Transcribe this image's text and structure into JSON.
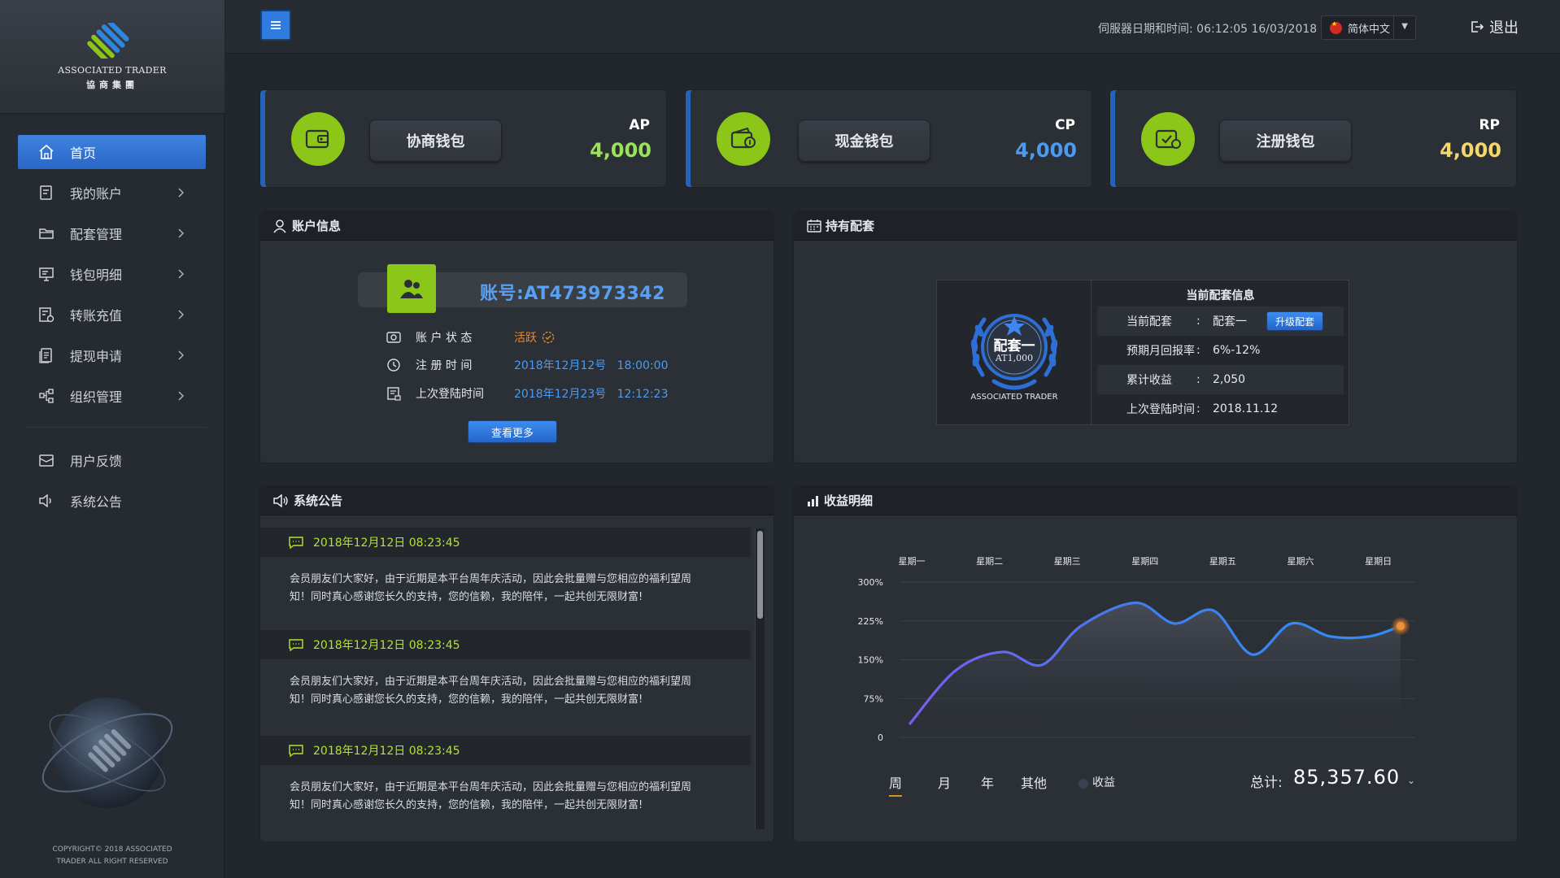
{
  "brand": {
    "name_en": "ASSOCIATED TRADER",
    "name_cn": "協商集團"
  },
  "sidebar": {
    "items": [
      {
        "label": "首页",
        "icon": "home-icon",
        "active": true
      },
      {
        "label": "我的账户",
        "icon": "account-icon"
      },
      {
        "label": "配套管理",
        "icon": "folder-icon"
      },
      {
        "label": "钱包明细",
        "icon": "monitor-icon"
      },
      {
        "label": "转账充值",
        "icon": "transfer-icon"
      },
      {
        "label": "提现申请",
        "icon": "document-icon"
      },
      {
        "label": "组织管理",
        "icon": "org-icon"
      }
    ],
    "secondary": [
      {
        "label": "用户反馈",
        "icon": "mail-icon"
      },
      {
        "label": "系统公告",
        "icon": "speaker-icon"
      }
    ],
    "copyright_line1": "COPYRIGHT© 2018 ASSOCIATED",
    "copyright_line2": "TRADER ALL RIGHT RESERVED"
  },
  "topbar": {
    "server_time": "伺服器日期和时间: 06:12:05 16/03/2018",
    "language": "简体中文",
    "logout": "退出"
  },
  "wallets": [
    {
      "label": "协商钱包",
      "code": "AP",
      "value": "4,000",
      "value_color": "#9be25a"
    },
    {
      "label": "现金钱包",
      "code": "CP",
      "value": "4,000",
      "value_color": "#4d9bf0"
    },
    {
      "label": "注册钱包",
      "code": "RP",
      "value": "4,000",
      "value_color": "#f3d768"
    }
  ],
  "account": {
    "title": "账户信息",
    "account_no": "账号:AT473973342",
    "status_label": "账 户 状 态",
    "status_value": "活跃",
    "status_color": "#f08a24",
    "reg_label": "注 册 时 间",
    "reg_value": "2018年12月12号   18:00:00",
    "last_login_label": "上次登陆时间",
    "last_login_value": "2018年12月23号   12:12:23",
    "more_button": "查看更多"
  },
  "package": {
    "title": "持有配套",
    "badge_main": "配套一",
    "badge_sub": "AT1,000",
    "badge_brand": "ASSOCIATED TRADER",
    "info_title": "当前配套信息",
    "rows": [
      {
        "key": "当前配套",
        "value": "配套一"
      },
      {
        "key": "预期月回报率",
        "value": "6%-12%"
      },
      {
        "key": "累计收益",
        "value": "2,050"
      },
      {
        "key": "上次登陆时间",
        "value": "2018.11.12"
      }
    ],
    "upgrade_button": "升级配套"
  },
  "notices": {
    "title": "系统公告",
    "items": [
      {
        "date": "2018年12月12日 08:23:45",
        "line1": "会员朋友们大家好，由于近期是本平台周年庆活动，因此会批量赠与您相应的福利望周",
        "line2": "知！同时真心感谢您长久的支持，您的信赖，我的陪伴，一起共创无限财富!"
      },
      {
        "date": "2018年12月12日 08:23:45",
        "line1": "会员朋友们大家好，由于近期是本平台周年庆活动，因此会批量赠与您相应的福利望周",
        "line2": "知！同时真心感谢您长久的支持，您的信赖，我的陪伴，一起共创无限财富!"
      },
      {
        "date": "2018年12月12日 08:23:45",
        "line1": "会员朋友们大家好，由于近期是本平台周年庆活动，因此会批量赠与您相应的福利望周",
        "line2": "知！同时真心感谢您长久的支持，您的信赖，我的陪伴，一起共创无限财富!"
      }
    ]
  },
  "earnings": {
    "title": "收益明细",
    "periods": [
      "周",
      "月",
      "年",
      "其他"
    ],
    "active_period": "周",
    "legend": "收益",
    "total_label": "总计:",
    "total_value": "85,357.60"
  },
  "chart_data": {
    "type": "line",
    "categories": [
      "星期一",
      "星期二",
      "星期三",
      "星期四",
      "星期五",
      "星期六",
      "星期日"
    ],
    "y_ticks": [
      "0",
      "75%",
      "150%",
      "225%",
      "300%"
    ],
    "ylim": [
      0,
      300
    ],
    "series": [
      {
        "name": "收益",
        "x": [
          0,
          0.6,
          1.2,
          1.7,
          2.2,
          2.9,
          3.4,
          3.9,
          4.4,
          4.9,
          5.4,
          5.9,
          6.3
        ],
        "values": [
          25,
          130,
          165,
          140,
          215,
          260,
          220,
          245,
          160,
          220,
          195,
          195,
          215
        ]
      }
    ],
    "grid": true,
    "area_fill": true
  }
}
